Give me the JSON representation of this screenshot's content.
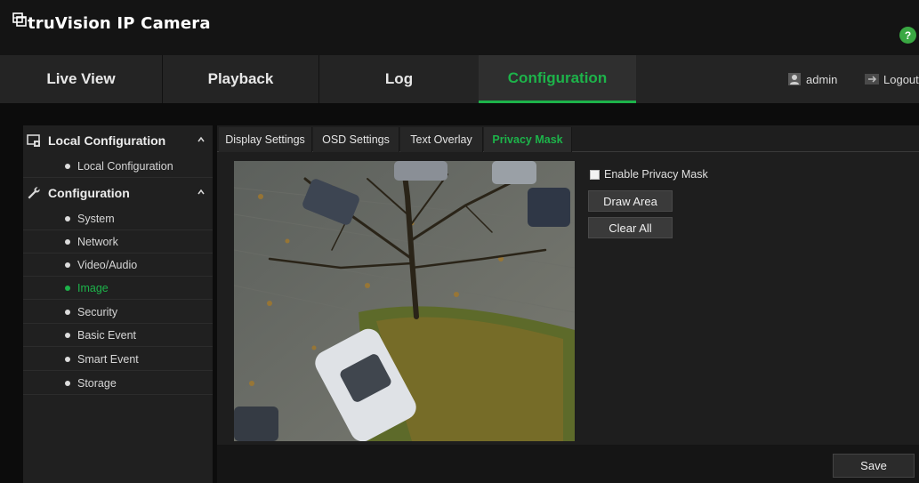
{
  "app": {
    "brand": "truVision IP Camera",
    "help_label": "?"
  },
  "nav": {
    "tabs": [
      {
        "label": "Live View"
      },
      {
        "label": "Playback"
      },
      {
        "label": "Log"
      },
      {
        "label": "Configuration",
        "active": true
      }
    ],
    "user": {
      "name": "admin",
      "logout_label": "Logout"
    }
  },
  "sidebar": {
    "sections": [
      {
        "title": "Local Configuration",
        "items": [
          "Local Configuration"
        ]
      },
      {
        "title": "Configuration",
        "items": [
          "System",
          "Network",
          "Video/Audio",
          "Image",
          "Security",
          "Basic Event",
          "Smart Event",
          "Storage"
        ],
        "active_item": "Image"
      }
    ]
  },
  "subtabs": [
    {
      "label": "Display Settings"
    },
    {
      "label": "OSD Settings"
    },
    {
      "label": "Text Overlay"
    },
    {
      "label": "Privacy Mask",
      "active": true
    }
  ],
  "privacy_mask": {
    "enable_label": "Enable Privacy Mask",
    "enabled": false,
    "draw_area_label": "Draw Area",
    "clear_all_label": "Clear All"
  },
  "footer": {
    "save_label": "Save"
  },
  "colors": {
    "accent": "#1db34a",
    "help": "#3aa843",
    "background": "#0c0c0c"
  }
}
